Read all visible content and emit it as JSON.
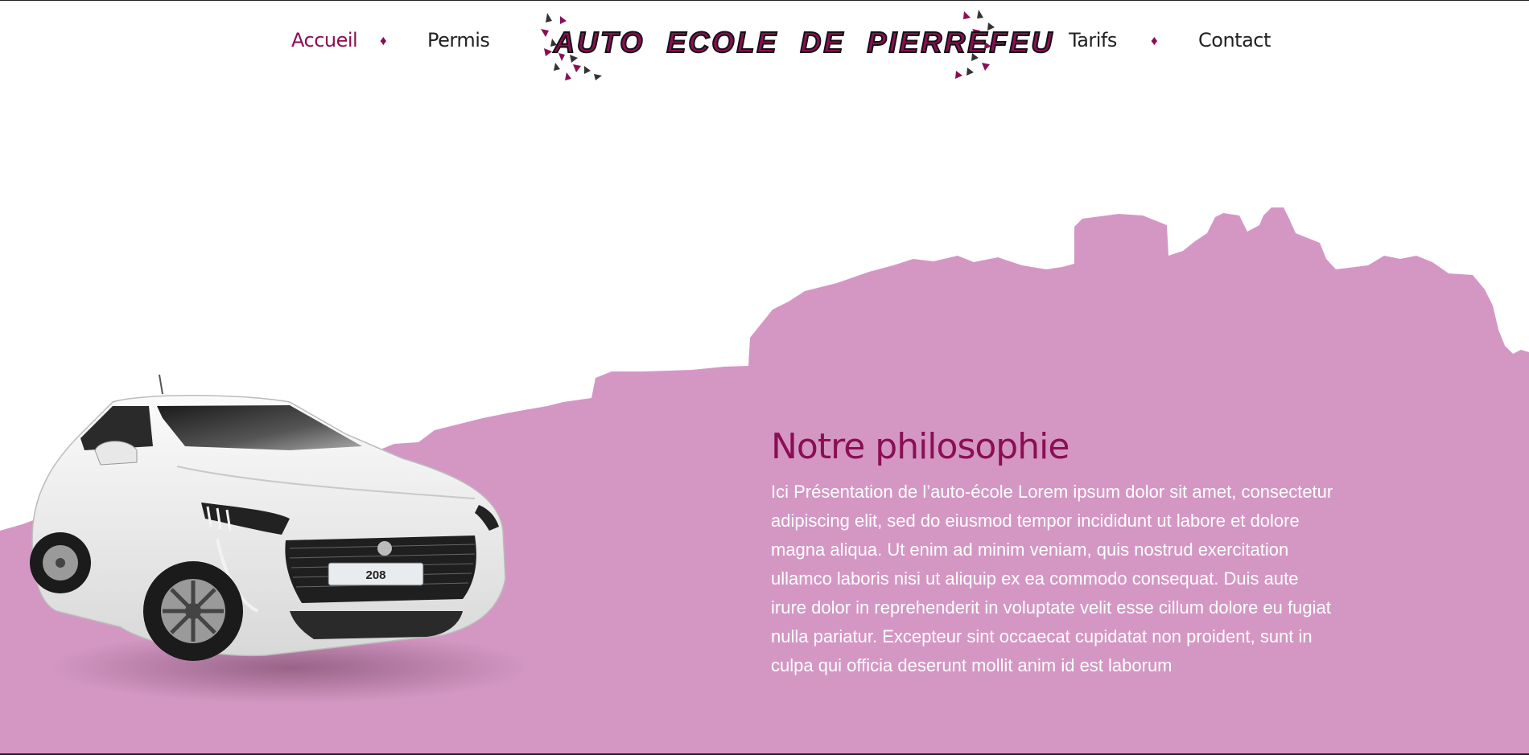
{
  "nav": {
    "items": [
      {
        "label": "Accueil",
        "active": true
      },
      {
        "label": "Permis",
        "active": false
      },
      {
        "label": "Tarifs",
        "active": false
      },
      {
        "label": "Contact",
        "active": false
      }
    ],
    "separator": "♦"
  },
  "logo": {
    "text": "AUTO ECOLE DE PIERREFEU"
  },
  "car": {
    "plate": "208",
    "badge": "208"
  },
  "section": {
    "title": "Notre philosophie",
    "body": "Ici Présentation de l’auto-école Lorem ipsum dolor sit amet, consectetur adipiscing elit, sed do eiusmod tempor incididunt ut labore et dolore magna aliqua. Ut enim ad minim veniam, quis nostrud exercitation ullamco laboris nisi ut aliquip ex ea commodo consequat. Duis aute irure dolor in reprehenderit in voluptate velit esse cillum dolore eu fugiat nulla pariatur. Excepteur sint occaecat cupidatat non proident, sunt in culpa qui officia deserunt mollit anim id est laborum"
  },
  "colors": {
    "accent": "#8b0e55",
    "landscape": "#d497c4",
    "text_dark": "#222222",
    "text_light": "#ffffff"
  },
  "icons": [
    "diamond-separator-icon",
    "leaf-decoration-icon"
  ]
}
